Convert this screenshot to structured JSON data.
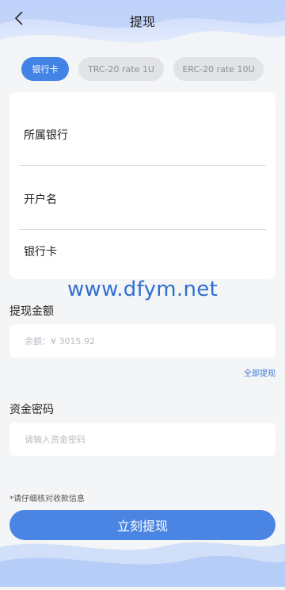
{
  "header": {
    "title": "提现",
    "back_icon": "chevron-left-icon"
  },
  "tabs": [
    {
      "label": "银行卡",
      "active": true
    },
    {
      "label": "TRC-20 rate 1U",
      "active": false
    },
    {
      "label": "ERC-20 rate 10U",
      "active": false
    }
  ],
  "bank_card": {
    "bank_label": "所属银行",
    "holder_label": "开户名",
    "card_label": "银行卡"
  },
  "watermark": "www.dfym.net",
  "amount": {
    "label": "提现金额",
    "placeholder": "余额：¥ 3015.92",
    "withdraw_all": "全部提现"
  },
  "password": {
    "label": "资金密码",
    "placeholder": "请输入资金密码"
  },
  "notice": "*请仔细核对收款信息",
  "submit_label": "立刻提现",
  "colors": {
    "accent": "#4a85e3",
    "tab_inactive_bg": "#e1e3e7",
    "background": "#f4f5f7"
  }
}
